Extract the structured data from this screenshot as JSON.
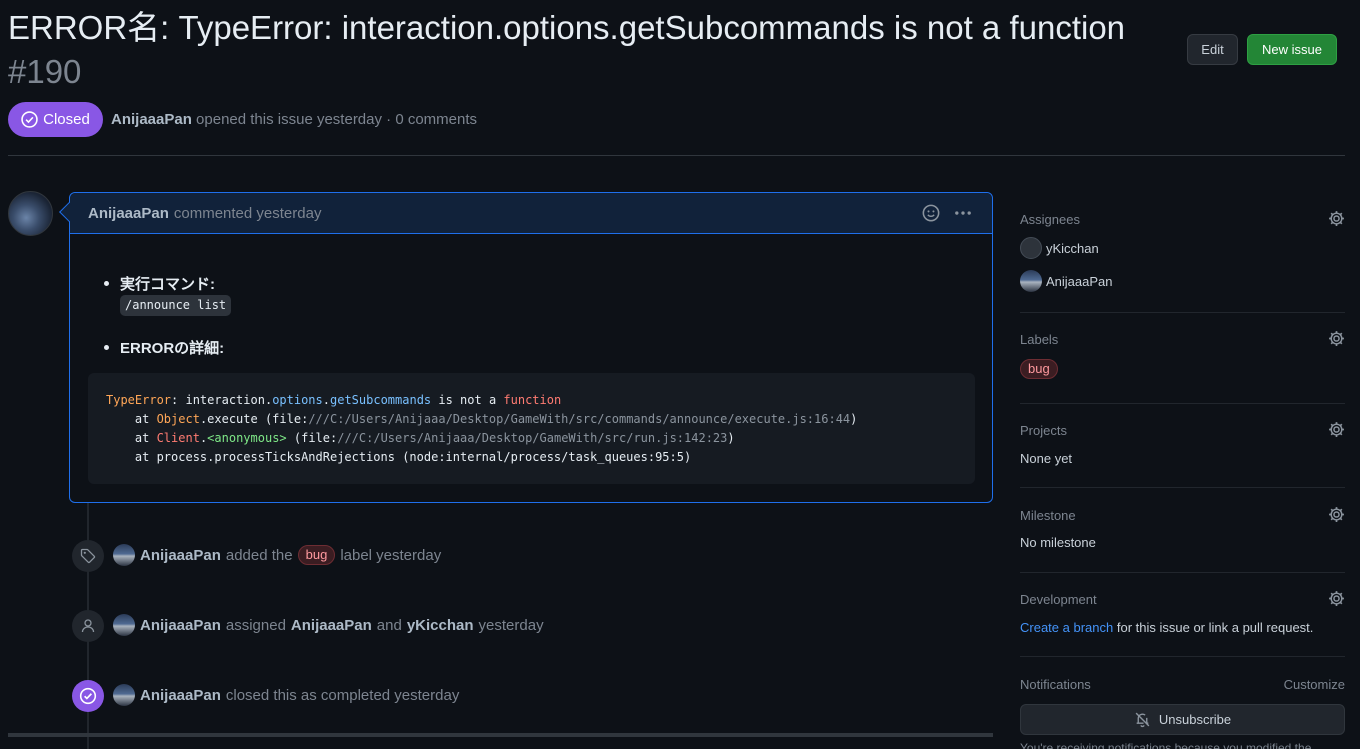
{
  "header": {
    "title": "ERROR名: TypeError: interaction.options.getSubcommands is not a function",
    "number": "#190",
    "edit_label": "Edit",
    "new_issue_label": "New issue",
    "state_label": "Closed",
    "author": "AnijaaaPan",
    "meta_text": "opened this issue yesterday · 0 comments"
  },
  "comment": {
    "author": "AnijaaaPan",
    "meta": "commented yesterday",
    "items": [
      {
        "label": "実行コマンド:"
      },
      {
        "label": "ERRORの詳細:"
      }
    ],
    "inline_code": "/announce list",
    "code_lines": [
      [
        "TypeError",
        ": interaction.",
        "options",
        ".",
        "getSubcommands",
        " is not a ",
        "function"
      ],
      [
        "    at ",
        "Object",
        ".execute (file:",
        "///C:/Users/Anijaaa/Desktop/GameWith/src/commands/announce/execute.js:16:44",
        ")"
      ],
      [
        "    at ",
        "Client",
        ".",
        "<anonymous>",
        " (file:",
        "///C:/Users/Anijaaa/Desktop/GameWith/src/run.js:142:23",
        ")"
      ],
      [
        "    at process.processTicksAndRejections (node:internal/process/task_queues:95:5)"
      ]
    ]
  },
  "timeline": [
    {
      "actor": "AnijaaaPan",
      "pre": "added the",
      "label": "bug",
      "post": "label yesterday"
    },
    {
      "actor": "AnijaaaPan",
      "pre": "assigned",
      "a1": "AnijaaaPan",
      "and": "and",
      "a2": "yKicchan",
      "post": "yesterday"
    },
    {
      "actor": "AnijaaaPan",
      "pre": "closed this as completed yesterday"
    }
  ],
  "sidebar": {
    "assignees_title": "Assignees",
    "assignees": [
      "yKicchan",
      "AnijaaaPan"
    ],
    "labels_title": "Labels",
    "label": "bug",
    "projects_title": "Projects",
    "projects_value": "None yet",
    "milestone_title": "Milestone",
    "milestone_value": "No milestone",
    "development_title": "Development",
    "development_link": "Create a branch",
    "development_text": "for this issue or link a pull request.",
    "notifications_title": "Notifications",
    "customize_label": "Customize",
    "unsubscribe_label": "Unsubscribe",
    "notification_text": "You're receiving notifications because you modified the"
  },
  "colors": {
    "closed": "#8957e5",
    "new_issue": "#238636",
    "link": "#4493f8",
    "comment_border": "#1f6feb"
  }
}
